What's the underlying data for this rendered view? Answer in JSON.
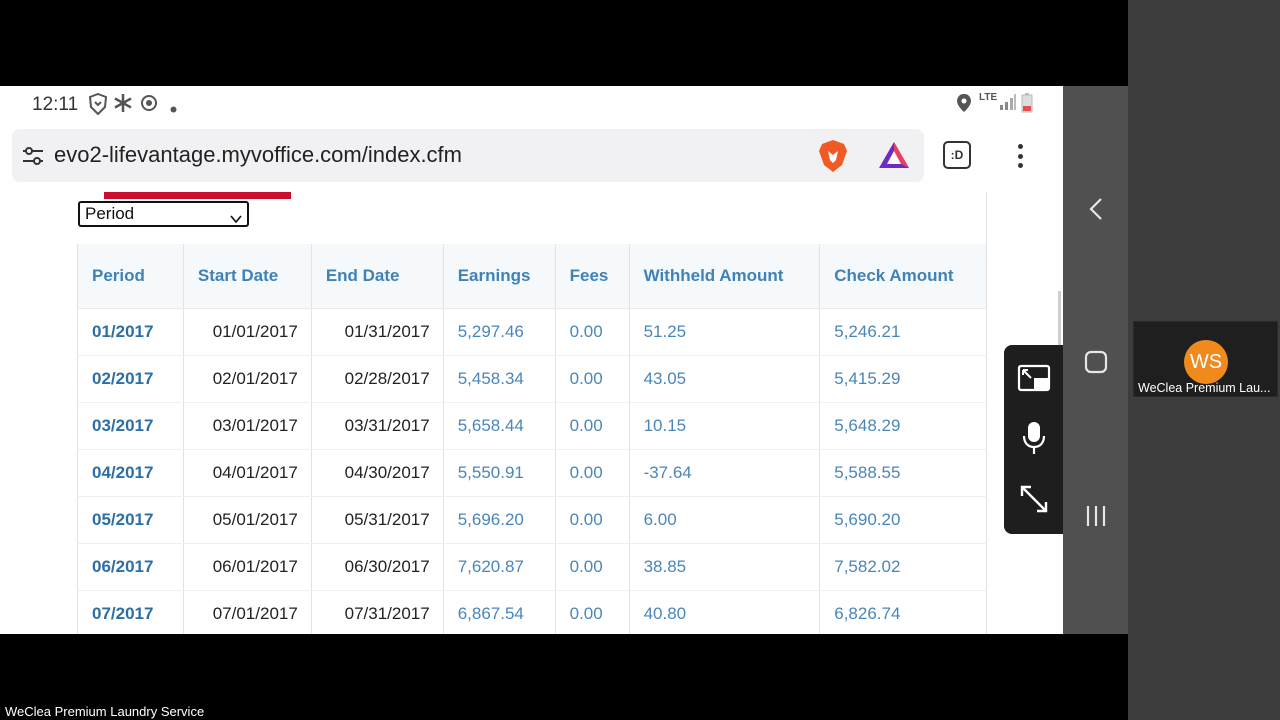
{
  "status_bar": {
    "time": "12:11",
    "network": "LTE"
  },
  "browser": {
    "url": "evo2-lifevantage.myvoffice.com/index.cfm",
    "tabs_label": ":D"
  },
  "page": {
    "select_value": "Period",
    "columns": [
      "Period",
      "Start Date",
      "End Date",
      "Earnings",
      "Fees",
      "Withheld Amount",
      "Check Amount"
    ],
    "rows": [
      [
        "01/2017",
        "01/01/2017",
        "01/31/2017",
        "5,297.46",
        "0.00",
        "51.25",
        "5,246.21"
      ],
      [
        "02/2017",
        "02/01/2017",
        "02/28/2017",
        "5,458.34",
        "0.00",
        "43.05",
        "5,415.29"
      ],
      [
        "03/2017",
        "03/01/2017",
        "03/31/2017",
        "5,658.44",
        "0.00",
        "10.15",
        "5,648.29"
      ],
      [
        "04/2017",
        "04/01/2017",
        "04/30/2017",
        "5,550.91",
        "0.00",
        "-37.64",
        "5,588.55"
      ],
      [
        "05/2017",
        "05/01/2017",
        "05/31/2017",
        "5,696.20",
        "0.00",
        "6.00",
        "5,690.20"
      ],
      [
        "06/2017",
        "06/01/2017",
        "06/30/2017",
        "7,620.87",
        "0.00",
        "38.85",
        "7,582.02"
      ],
      [
        "07/2017",
        "07/01/2017",
        "07/31/2017",
        "6,867.54",
        "0.00",
        "40.80",
        "6,826.74"
      ]
    ]
  },
  "participant": {
    "initials": "WS",
    "name": "WeClea Premium Lau..."
  },
  "meeting": {
    "label": "WeClea Premium Laundry Service"
  },
  "colors": {
    "link": "#3e82b8",
    "accent_red": "#c8102e",
    "avatar": "#f08a1c"
  }
}
